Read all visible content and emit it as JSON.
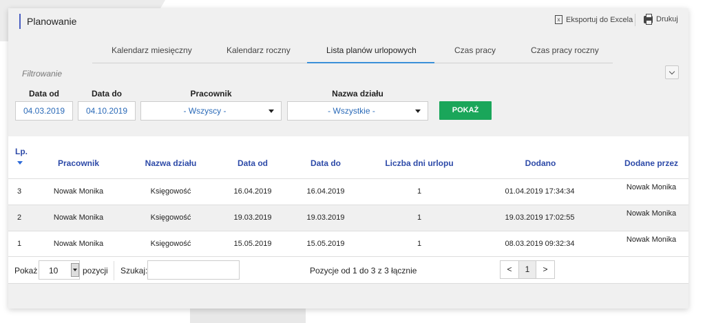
{
  "header": {
    "title": "Planowanie",
    "export_label": "Eksportuj do Excela",
    "print_label": "Drukuj"
  },
  "tabs": [
    {
      "label": "Kalendarz miesięczny"
    },
    {
      "label": "Kalendarz roczny"
    },
    {
      "label": "Lista planów urlopowych",
      "active": true
    },
    {
      "label": "Czas pracy"
    },
    {
      "label": "Czas pracy roczny"
    }
  ],
  "filters": {
    "title": "Filtrowanie",
    "date_from_label": "Data od",
    "date_from_value": "04.03.2019",
    "date_to_label": "Data do",
    "date_to_value": "04.10.2019",
    "employee_label": "Pracownik",
    "employee_value": "- Wszyscy -",
    "department_label": "Nazwa działu",
    "department_value": "- Wszystkie -",
    "show_button": "POKAŻ"
  },
  "table": {
    "columns": [
      "Lp.",
      "Pracownik",
      "Nazwa działu",
      "Data od",
      "Data do",
      "Liczba dni urlopu",
      "Dodano",
      "Dodane przez"
    ],
    "rows": [
      [
        "3",
        "Nowak Monika",
        "Księgowość",
        "16.04.2019",
        "16.04.2019",
        "1",
        "01.04.2019 17:34:34",
        "Nowak Monika"
      ],
      [
        "2",
        "Nowak Monika",
        "Księgowość",
        "19.03.2019",
        "19.03.2019",
        "1",
        "19.03.2019 17:02:55",
        "Nowak Monika"
      ],
      [
        "1",
        "Nowak Monika",
        "Księgowość",
        "15.05.2019",
        "15.05.2019",
        "1",
        "08.03.2019 09:32:34",
        "Nowak Monika"
      ]
    ]
  },
  "footer": {
    "show_label": "Pokaż",
    "page_length": "10",
    "entries_label": "pozycji",
    "search_label": "Szukaj:",
    "search_value": "",
    "info": "Pozycje od 1 do 3 z 3 łącznie",
    "prev": "<",
    "current_page": "1",
    "next": ">"
  },
  "colors": {
    "accent_blue": "#3a8fd8",
    "header_text_blue": "#2d4aa8",
    "show_button_green": "#1aa65a",
    "title_bar": "#4a5fc1"
  }
}
